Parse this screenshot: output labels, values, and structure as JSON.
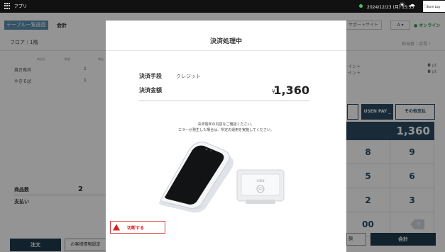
{
  "titlebar": {
    "app_name": "アプリ",
    "datetime": "2024/12/23 (月) 15:53",
    "store_label": "Store Log"
  },
  "header": {
    "table_list_tab": "テーブル一覧画面",
    "title": "会計",
    "support_site": "サポートサイト",
    "language": "A ▾",
    "online_status": "● オンライン"
  },
  "subheader": {
    "floor": "フロア｜1階",
    "staff": "担当者｜店長 〉"
  },
  "orders": {
    "columns": [
      "商品名",
      "数量",
      "商品"
    ],
    "rows": [
      {
        "name": "焼き鳥丼",
        "qty": "1"
      },
      {
        "name": "やきそば",
        "qty": "1"
      }
    ]
  },
  "summary": {
    "count_label": "商品数",
    "count_value": "2",
    "payment_label": "支払い"
  },
  "bottom_left": {
    "order_button": "注文",
    "customer_button": "お客様情報設定"
  },
  "right_panel": {
    "points": [
      {
        "label": "イント",
        "value": "0",
        "unit": "pt"
      },
      {
        "label": "イント",
        "value": "0",
        "unit": "pt"
      }
    ],
    "usen_pay_button": "USEN PAY _",
    "other_payment_button": "その他支払",
    "amount_display": "1,360",
    "keypad": [
      "8",
      "9",
      "5",
      "6",
      "2",
      "3",
      "00"
    ],
    "hold_button": "額",
    "checkout_button": "会計"
  },
  "modal": {
    "title": "決済処理中",
    "method_label": "決済手段",
    "method_value": "クレジット",
    "amount_label": "決済金額",
    "currency_symbol": "¥",
    "amount_value": "1,360",
    "instruction_line1": "決済端末の内容をご確認ください。",
    "instruction_line2": "エラーが発生した場合は、所定の運用を実施してください。",
    "disconnect_button": "切断する",
    "reader_brand": "USEN"
  },
  "colors": {
    "navy": "#2b4a63",
    "dark_navy": "#1f3c4f",
    "danger": "#d81f1f",
    "online": "#2a9a4b"
  }
}
